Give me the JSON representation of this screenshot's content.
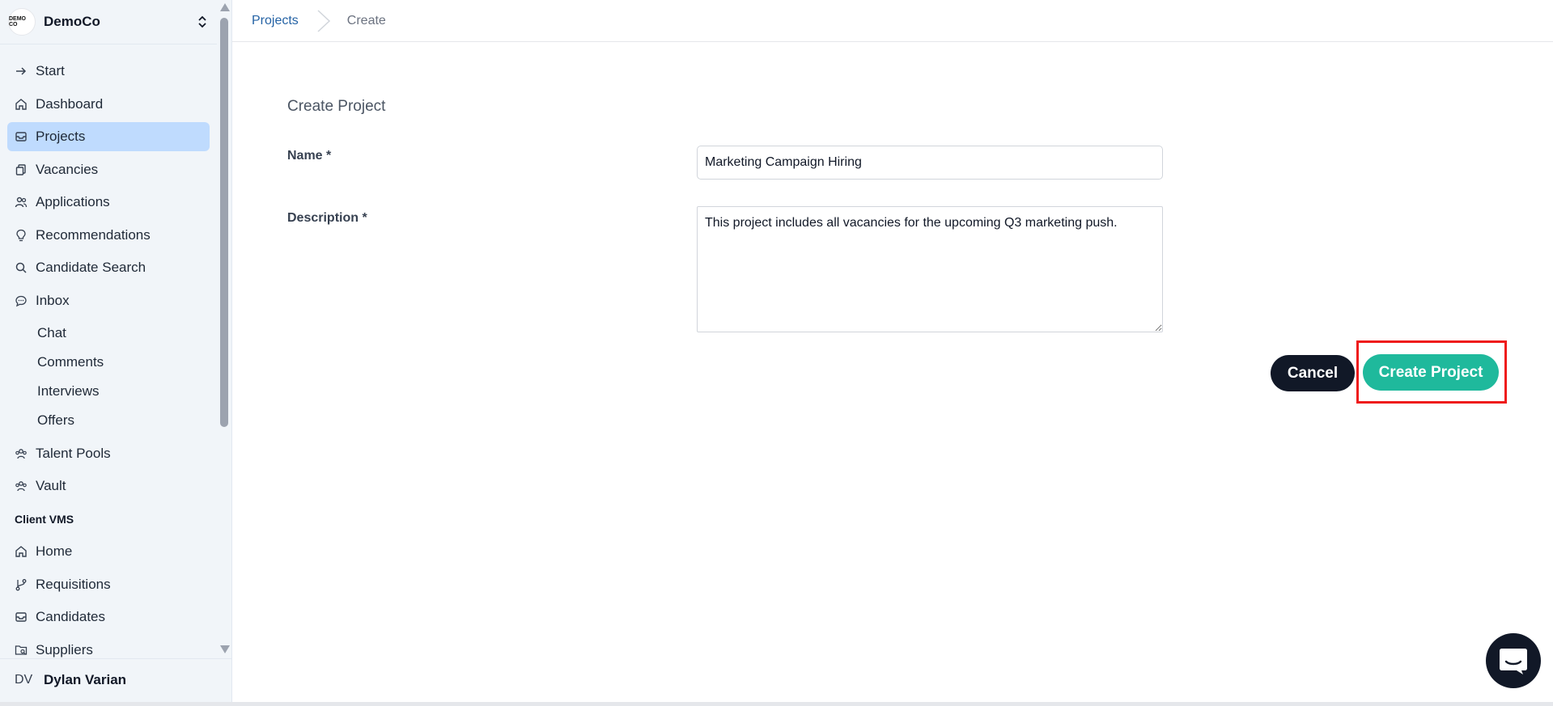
{
  "org": {
    "name": "DemoCo",
    "logo_text": "DEMO CO"
  },
  "breadcrumb": {
    "parent": "Projects",
    "current": "Create"
  },
  "nav": {
    "start": "Start",
    "dashboard": "Dashboard",
    "projects": "Projects",
    "vacancies": "Vacancies",
    "applications": "Applications",
    "recommendations": "Recommendations",
    "candidate_search": "Candidate Search",
    "inbox": "Inbox",
    "chat": "Chat",
    "comments": "Comments",
    "interviews": "Interviews",
    "offers": "Offers",
    "talent_pools": "Talent Pools",
    "vault": "Vault",
    "client_vms": "Client VMS",
    "home": "Home",
    "requisitions": "Requisitions",
    "candidates": "Candidates",
    "suppliers": "Suppliers"
  },
  "user": {
    "initials": "DV",
    "name": "Dylan Varian"
  },
  "form": {
    "title": "Create Project",
    "name_label": "Name *",
    "name_value": "Marketing Campaign Hiring",
    "description_label": "Description *",
    "description_value": "This project includes all vacancies for the upcoming Q3 marketing push.",
    "cancel_label": "Cancel",
    "create_label": "Create Project"
  },
  "colors": {
    "accent": "#1fb99c",
    "active_nav": "#bfdbfe",
    "highlight": "#ef1b1b",
    "dark": "#111827"
  }
}
